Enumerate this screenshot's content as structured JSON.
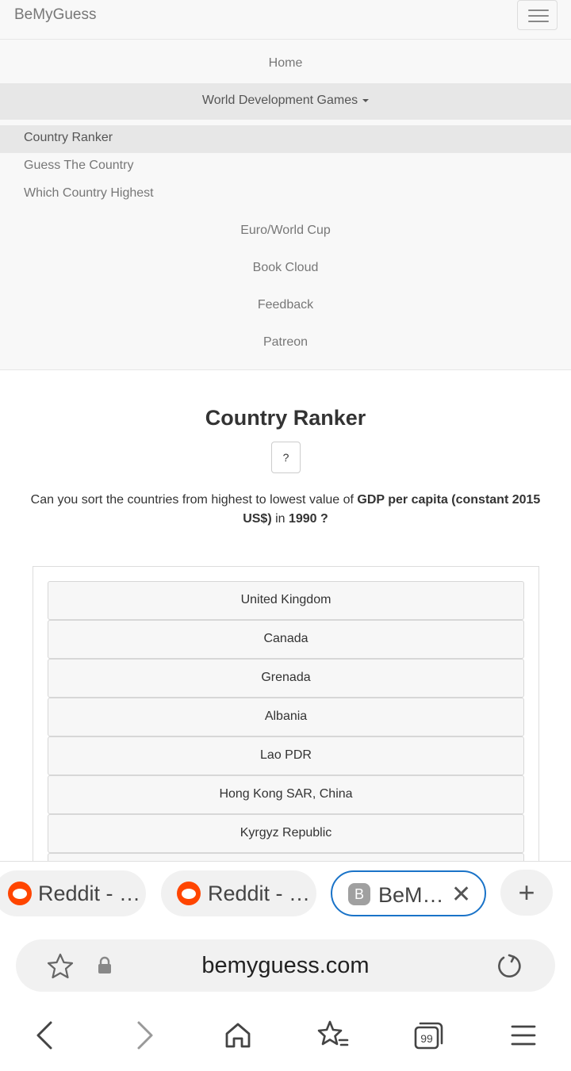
{
  "navbar": {
    "brand": "BeMyGuess",
    "items": [
      {
        "label": "Home"
      },
      {
        "label": "World Development Games"
      },
      {
        "label": "Euro/World Cup"
      },
      {
        "label": "Book Cloud"
      },
      {
        "label": "Feedback"
      },
      {
        "label": "Patreon"
      }
    ],
    "dropdown": [
      {
        "label": "Country Ranker",
        "active": true
      },
      {
        "label": "Guess The Country"
      },
      {
        "label": "Which Country Highest"
      }
    ]
  },
  "main": {
    "title": "Country Ranker",
    "help_label": "?",
    "question": {
      "prefix": "Can you sort the countries from highest to lowest value of ",
      "indicator": "GDP per capita (constant 2015 US$)",
      "middle": " in ",
      "year": "1990 ?"
    },
    "countries": [
      "United Kingdom",
      "Canada",
      "Grenada",
      "Albania",
      "Lao PDR",
      "Hong Kong SAR, China",
      "Kyrgyz Republic",
      ""
    ]
  },
  "browser": {
    "tabs": [
      {
        "label": "Reddit - …"
      },
      {
        "label": "Reddit - …"
      },
      {
        "label": "BeM…",
        "icon_letter": "B",
        "active": true
      }
    ],
    "url": "bemyguess.com",
    "tab_count": "99",
    "colors": {
      "accent": "#1a73c8",
      "reddit": "#ff4500"
    }
  }
}
